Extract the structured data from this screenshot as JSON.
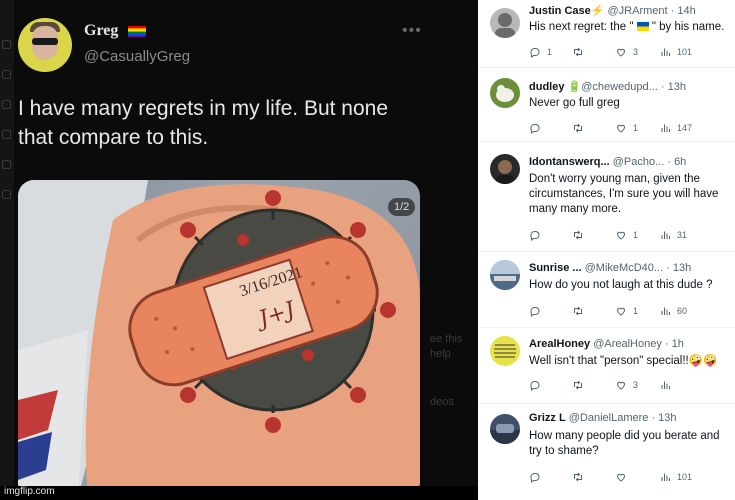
{
  "original_tweet": {
    "name": "Greg",
    "handle": "@CasuallyGreg",
    "text": "I have many regrets in my life. But none that compare to this.",
    "image_counter": "1/2",
    "tattoo_text": "3/16/2021",
    "tattoo_initials": "J+J"
  },
  "watermark": "imgflip.com",
  "background_fragments": [
    "ee this",
    "help",
    "deos"
  ],
  "replies": [
    {
      "name": "Justin Case",
      "badge": "⚡",
      "handle": "@JRArment",
      "time": "· 14h",
      "text_before_flag": "His next regret: the \" ",
      "text_after_flag": " \" by his name.",
      "replies": "1",
      "retweets": "",
      "likes": "3",
      "views": "101",
      "avatar_color": "#b8b8b8"
    },
    {
      "name": "dudley",
      "badge": "🔋",
      "handle": "@chewedupd...",
      "time": "· 13h",
      "text": "Never go full greg",
      "replies": "",
      "retweets": "",
      "likes": "1",
      "views": "147",
      "avatar_color": "#6b8f3a"
    },
    {
      "name": "Idontanswerq...",
      "badge": "",
      "handle": "@Pacho...",
      "time": "· 6h",
      "text": "Don't worry young man,  given the circumstances,  I'm sure you will have many many more.",
      "replies": "",
      "retweets": "",
      "likes": "1",
      "views": "31",
      "avatar_color": "#2a2a2a"
    },
    {
      "name": "Sunrise ...",
      "badge": "",
      "handle": "@MikeMcD40...",
      "time": "· 13h",
      "text": "How do you not laugh at this dude ?",
      "replies": "",
      "retweets": "",
      "likes": "1",
      "views": "60",
      "avatar_color": "#7fa0c4"
    },
    {
      "name": "ArealHoney",
      "badge": "",
      "handle": "@ArealHoney",
      "time": "· 1h",
      "text": "Well isn't that \"person\" special!!🤪🤪",
      "replies": "",
      "retweets": "",
      "likes": "3",
      "views": "",
      "avatar_color": "#e6e34a"
    },
    {
      "name": "Grizz L",
      "badge": "",
      "handle": "@DanielLamere",
      "time": "· 13h",
      "text": "How many people did you berate and try to shame?",
      "replies": "",
      "retweets": "",
      "likes": "",
      "views": "101",
      "avatar_color": "#41506a"
    }
  ],
  "icons": {
    "reply": "reply-icon",
    "retweet": "retweet-icon",
    "like": "heart-icon",
    "views": "views-icon"
  }
}
